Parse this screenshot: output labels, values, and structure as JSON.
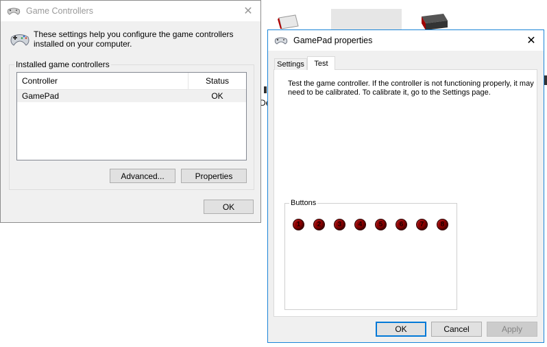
{
  "background": {
    "partial_label": "De"
  },
  "game_controllers": {
    "title": "Game Controllers",
    "intro_text": "These settings help you configure the game controllers installed on your computer.",
    "group_label": "Installed game controllers",
    "columns": {
      "controller": "Controller",
      "status": "Status"
    },
    "rows": [
      {
        "controller": "GamePad",
        "status": "OK"
      }
    ],
    "advanced_button": "Advanced...",
    "properties_button": "Properties",
    "ok_button": "OK"
  },
  "gamepad_properties": {
    "title": "GamePad properties",
    "tabs": [
      "Settings",
      "Test"
    ],
    "selected_tab": "Test",
    "test_text": "Test the game controller.  If the controller is not functioning properly, it may need to be calibrated.  To calibrate it, go to the Settings page.",
    "buttons_group_label": "Buttons",
    "buttons": [
      "1",
      "2",
      "3",
      "4",
      "5",
      "6",
      "7",
      "8"
    ],
    "ok_button": "OK",
    "cancel_button": "Cancel",
    "apply_button": "Apply"
  },
  "colors": {
    "accent": "#0078d7",
    "button_indicator": "#8b0000"
  },
  "icons": {
    "gamepad": "gamepad-icon",
    "close": "close-icon"
  }
}
